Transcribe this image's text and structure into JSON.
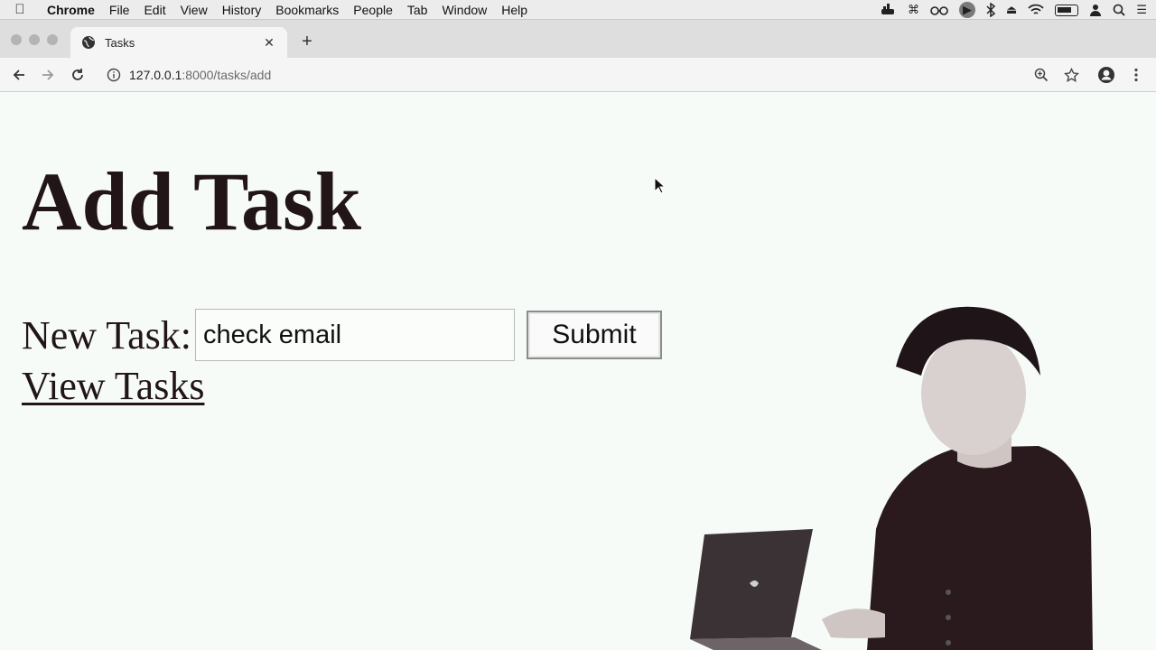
{
  "menubar": {
    "items": [
      "Chrome",
      "File",
      "Edit",
      "View",
      "History",
      "Bookmarks",
      "People",
      "Tab",
      "Window",
      "Help"
    ],
    "status_icons": [
      "docker-icon",
      "command-icon",
      "glasses-icon",
      "play-circle-icon",
      "bluetooth-icon",
      "eject-icon",
      "wifi-icon",
      "battery-icon",
      "user-icon",
      "search-icon",
      "list-icon"
    ]
  },
  "browser": {
    "tab_title": "Tasks",
    "url_host": "127.0.0.1",
    "url_rest": ":8000/tasks/add"
  },
  "page": {
    "title": "Add Task",
    "form_label": "New Task:",
    "input_value": "check email",
    "submit_label": "Submit",
    "view_link": "View Tasks"
  },
  "colors": {
    "page_bg": "#f7fbf8",
    "text": "#221517",
    "chrome_bg": "#dedede"
  }
}
